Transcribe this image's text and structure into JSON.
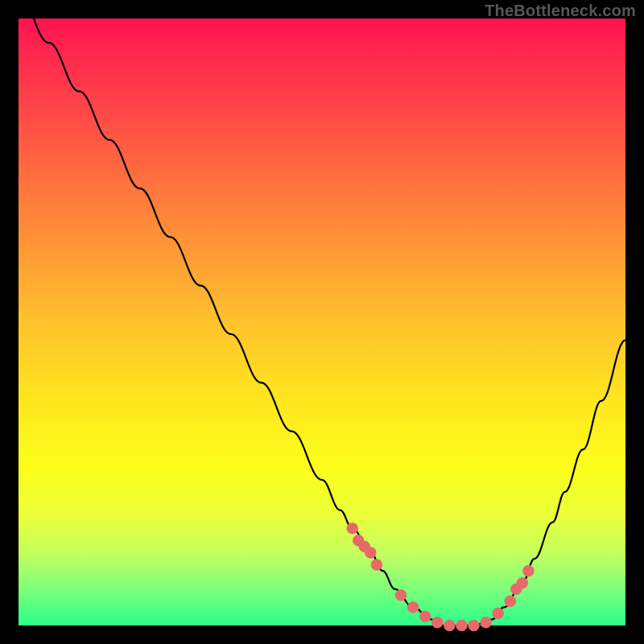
{
  "watermark": "TheBottleneck.com",
  "colors": {
    "background": "#000000",
    "marker": "#e66a6a",
    "curve": "#000000"
  },
  "chart_data": {
    "type": "line",
    "title": "",
    "xlabel": "",
    "ylabel": "",
    "xlim": [
      0,
      100
    ],
    "ylim": [
      0,
      100
    ],
    "grid": false,
    "series": [
      {
        "name": "bottleneck-curve",
        "x": [
          0,
          5,
          10,
          15,
          20,
          25,
          30,
          35,
          40,
          45,
          50,
          53,
          55,
          58,
          60,
          62,
          65,
          68,
          70,
          72,
          75,
          78,
          80,
          83,
          85,
          88,
          90,
          93,
          96,
          100
        ],
        "values": [
          104,
          96,
          88,
          80,
          72,
          64,
          56,
          48,
          40,
          32,
          24,
          19,
          16,
          12,
          9,
          6,
          3,
          1,
          0,
          0,
          0,
          1,
          3,
          7,
          11,
          17,
          22,
          29,
          37,
          47
        ]
      }
    ],
    "markers": {
      "name": "highlight-points",
      "x": [
        55,
        56,
        57,
        58,
        59,
        63,
        65,
        67,
        69,
        71,
        73,
        75,
        77,
        79,
        81,
        82,
        83,
        84
      ],
      "values": [
        16,
        14,
        13,
        12,
        10,
        5,
        3,
        1.5,
        0.5,
        0,
        0,
        0,
        0.5,
        2,
        4,
        6,
        7,
        9
      ]
    }
  }
}
